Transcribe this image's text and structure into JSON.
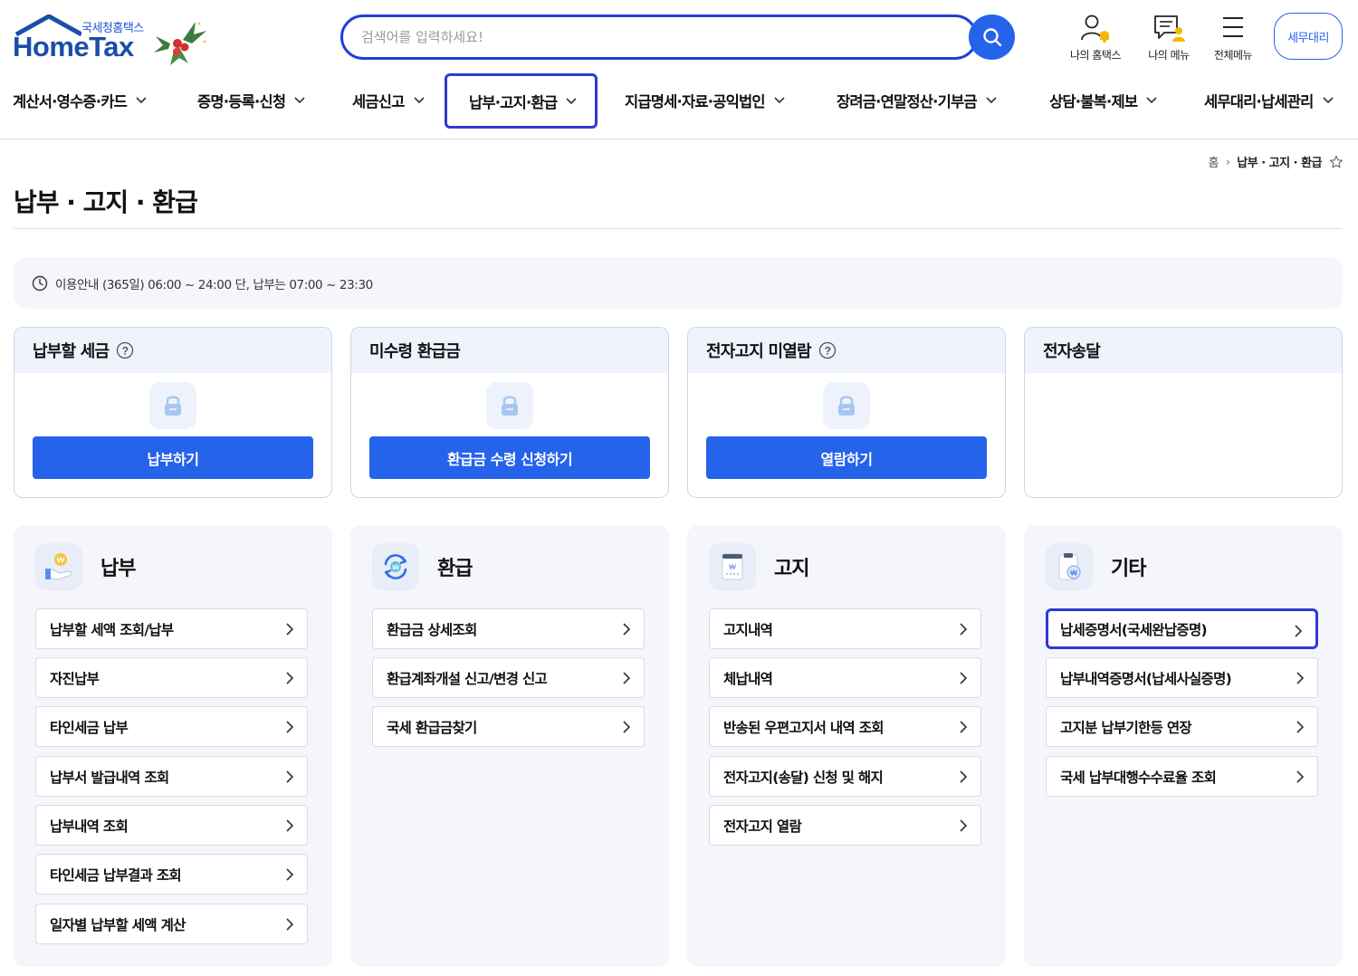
{
  "header": {
    "logo_small": "국세청홈택스",
    "logo_big": "HomeTax",
    "search_placeholder": "검색어를 입력하세요!",
    "utils": [
      {
        "label": "나의 홈택스",
        "icon": "person-bell-icon"
      },
      {
        "label": "나의 메뉴",
        "icon": "menu-person-icon"
      },
      {
        "label": "전체메뉴",
        "icon": "hamburger-icon"
      }
    ],
    "tax_agent_label": "세무대리"
  },
  "nav": [
    {
      "label": "계산서·영수증·카드",
      "active": false
    },
    {
      "label": "증명·등록·신청",
      "active": false
    },
    {
      "label": "세금신고",
      "active": false
    },
    {
      "label": "납부·고지·환급",
      "active": true
    },
    {
      "label": "지급명세·자료·공익법인",
      "active": false
    },
    {
      "label": "장려금·연말정산·기부금",
      "active": false
    },
    {
      "label": "상담·불복·제보",
      "active": false
    },
    {
      "label": "세무대리·납세관리",
      "active": false
    }
  ],
  "breadcrumb": {
    "home": "홈",
    "current": "납부 · 고지 · 환급"
  },
  "page_title": "납부 · 고지 · 환급",
  "notice": "이용안내 (365일) 06:00 ~ 24:00 단, 납부는 07:00 ~ 23:30",
  "cards": [
    {
      "title": "납부할 세금",
      "help": true,
      "action": "납부하기"
    },
    {
      "title": "미수령 환급금",
      "help": false,
      "action": "환급금 수령 신청하기"
    },
    {
      "title": "전자고지 미열람",
      "help": true,
      "action": "열람하기"
    },
    {
      "title": "전자송달",
      "help": false,
      "action": ""
    }
  ],
  "panels": [
    {
      "title": "납부",
      "icon": "coin-hand-icon",
      "links": [
        {
          "label": "납부할 세액 조회/납부",
          "active": false
        },
        {
          "label": "자진납부",
          "active": false
        },
        {
          "label": "타인세금 납부",
          "active": false
        },
        {
          "label": "납부서 발급내역 조회",
          "active": false
        },
        {
          "label": "납부내역 조회",
          "active": false
        },
        {
          "label": "타인세금 납부결과 조회",
          "active": false
        },
        {
          "label": "일자별 납부할 세액 계산",
          "active": false
        }
      ]
    },
    {
      "title": "환급",
      "icon": "refund-cycle-icon",
      "links": [
        {
          "label": "환급금 상세조회",
          "active": false
        },
        {
          "label": "환급계좌개설 신고/변경 신고",
          "active": false
        },
        {
          "label": "국세 환급금찾기",
          "active": false
        }
      ]
    },
    {
      "title": "고지",
      "icon": "notice-document-icon",
      "links": [
        {
          "label": "고지내역",
          "active": false
        },
        {
          "label": "체납내역",
          "active": false
        },
        {
          "label": "반송된 우편고지서 내역 조회",
          "active": false
        },
        {
          "label": "전자고지(송달) 신청 및 해지",
          "active": false
        },
        {
          "label": "전자고지 열람",
          "active": false
        }
      ]
    },
    {
      "title": "기타",
      "icon": "clipboard-coin-icon",
      "links": [
        {
          "label": "납세증명서(국세완납증명)",
          "active": true
        },
        {
          "label": "납부내역증명서(납세사실증명)",
          "active": false
        },
        {
          "label": "고지분 납부기한등 연장",
          "active": false
        },
        {
          "label": "국세 납부대행수수료율 조회",
          "active": false
        }
      ]
    }
  ],
  "colors": {
    "primary": "#2563eb",
    "highlight_border": "#2d3ad6",
    "panel_bg": "#f4f6fb",
    "card_head_bg": "#eef3fc"
  }
}
